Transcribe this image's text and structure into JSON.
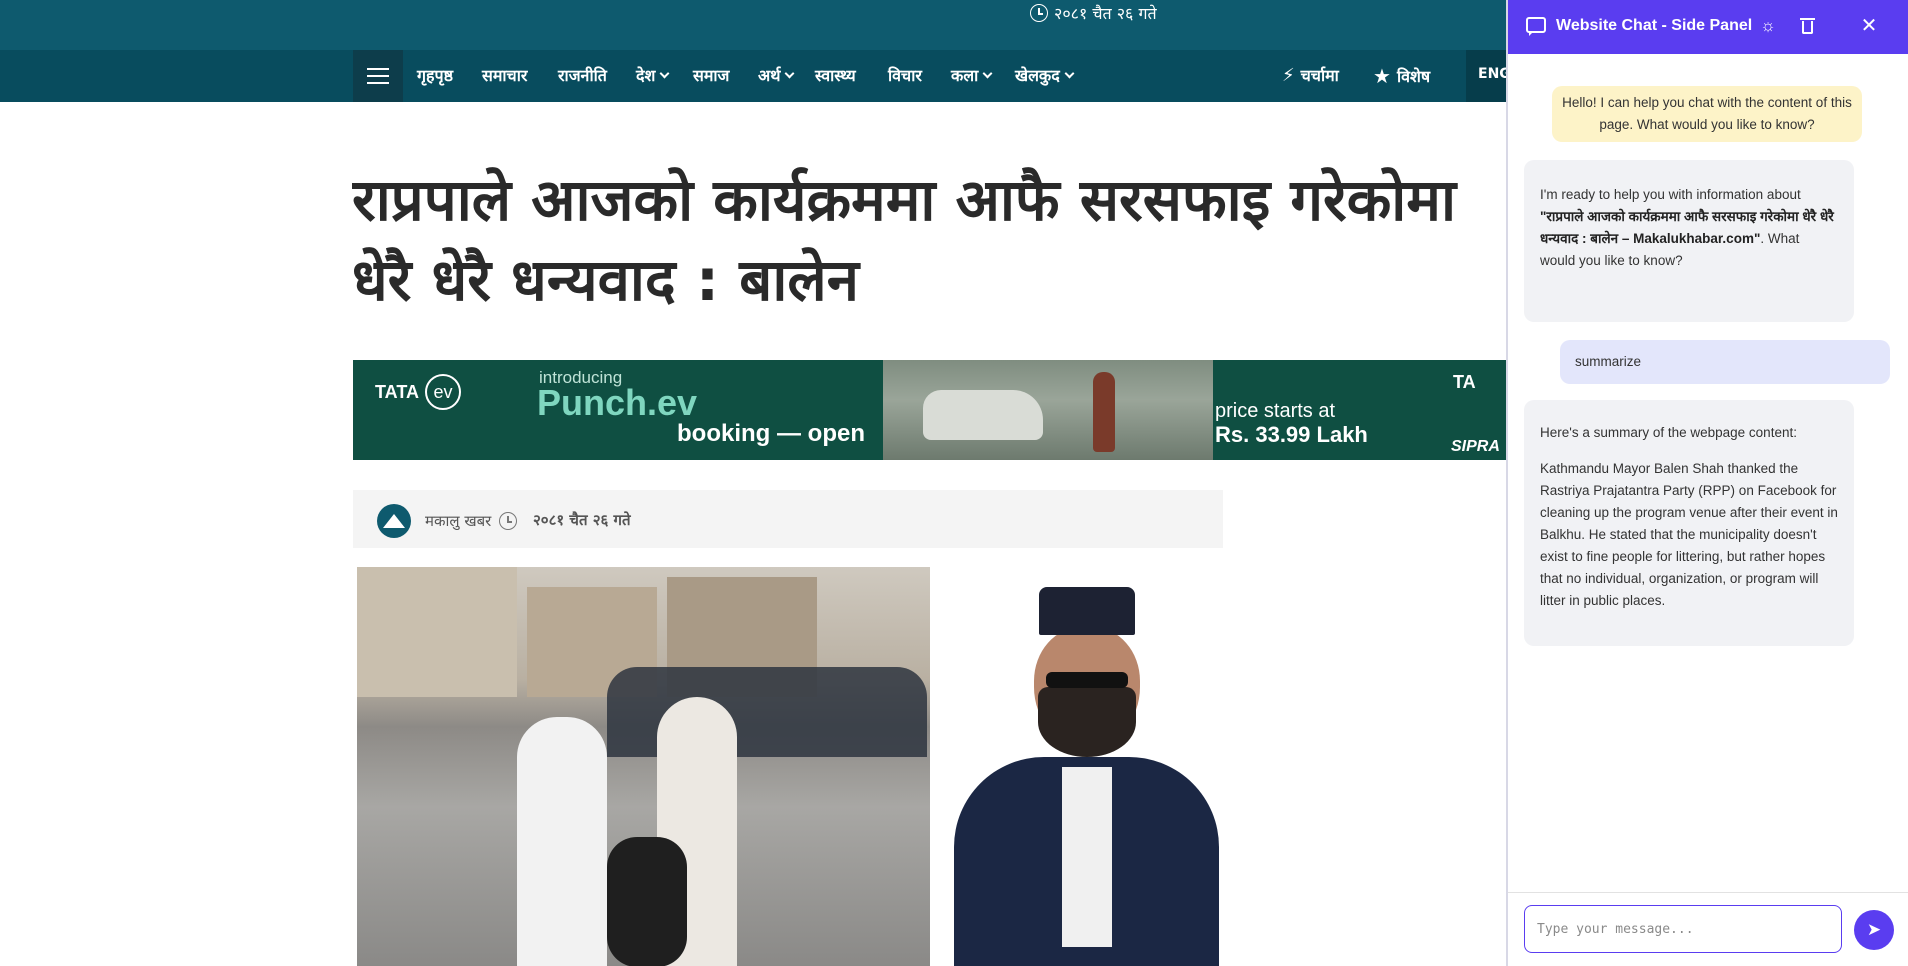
{
  "site": {
    "top_date": "२०८१ चैत २६ गते",
    "nav": [
      {
        "label": "गृहपृष्ठ"
      },
      {
        "label": "समाचार"
      },
      {
        "label": "राजनीति"
      },
      {
        "label": "देश"
      },
      {
        "label": "समाज"
      },
      {
        "label": "अर्थ"
      },
      {
        "label": "स्वास्थ्य"
      },
      {
        "label": "विचार"
      },
      {
        "label": "कला"
      },
      {
        "label": "खेलकुद"
      }
    ],
    "nav_right": [
      {
        "label": "चर्चामा",
        "icon": "bolt-icon"
      },
      {
        "label": "विशेष",
        "icon": "star-icon"
      }
    ],
    "lang": "ENG",
    "headline": {
      "line1": "राप्रपाले आजको कार्यक्रममा आफै सरसफाइ गरेकोमा",
      "line2": "धेरै धेरै धन्यवाद : बालेन"
    },
    "ad": {
      "brand": "TATA",
      "brand_badge": "ev",
      "intro": "introducing",
      "product": "Punch.ev",
      "booking": "booking — open",
      "price_line1": "price starts at",
      "price_line2": "Rs. 33.99 Lakh",
      "right_brand": "TA",
      "right_tag": "SIPRA"
    },
    "byline": {
      "author": "मकालु खबर",
      "date": "२०८१ चैत २६ गते"
    }
  },
  "chat": {
    "title": "Website Chat - Side Panel",
    "accent": "#5a3df0",
    "header_icons": [
      "chat-icon",
      "sun-icon",
      "trash-icon",
      "close-icon"
    ],
    "messages": {
      "greeting": "Hello! I can help you chat with the content of this page. What would you like to know?",
      "ready_prefix": "I'm ready to help you with information about ",
      "ready_title": "\"राप्रपाले आजको कार्यक्रममा आफै सरसफाइ गरेकोमा धेरै धेरै धन्यवाद : बालेन – Makalukhabar.com\"",
      "ready_suffix": ". What would you like to know?",
      "user_query": "summarize",
      "summary_intro": "Here's a summary of the webpage content:",
      "summary_body": "Kathmandu Mayor Balen Shah thanked the Rastriya Prajatantra Party (RPP) on Facebook for cleaning up the program venue after their event in Balkhu. He stated that the municipality doesn't exist to fine people for littering, but rather hopes that no individual, organization, or program will litter in public places."
    },
    "input": {
      "placeholder": "Type your message...",
      "value": ""
    }
  }
}
